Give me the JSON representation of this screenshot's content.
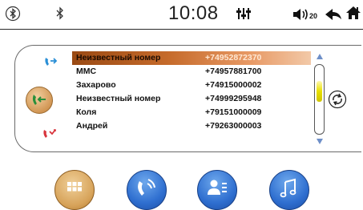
{
  "status_bar": {
    "time": "10:08",
    "volume_level": "20",
    "icons": [
      "bluetooth-circle-icon",
      "bluetooth-icon",
      "equalizer-icon",
      "volume-icon",
      "back-icon",
      "home-icon"
    ]
  },
  "call_history": {
    "filters": [
      "outgoing-call-icon",
      "all-calls-icon",
      "missed-call-icon"
    ],
    "selected_filter": "all-calls",
    "rows": [
      {
        "name": "Неизвестный номер",
        "number": "+74952872370",
        "selected": true
      },
      {
        "name": "MMC",
        "number": "+74957881700",
        "selected": false
      },
      {
        "name": "Захарово",
        "number": "+74915000002",
        "selected": false
      },
      {
        "name": "Неизвестный номер",
        "number": "+74999295948",
        "selected": false
      },
      {
        "name": "Коля",
        "number": "+79151000009",
        "selected": false
      },
      {
        "name": "Андрей",
        "number": "+79263000003",
        "selected": false
      }
    ],
    "scroll_position": 0.25
  },
  "bottom_nav": {
    "buttons": [
      "menu-grid-icon",
      "phone-calls-icon",
      "contacts-icon",
      "music-icon"
    ]
  },
  "colors": {
    "accent_orange": "#c56a2a",
    "nav_blue": "#2f6fd0",
    "nav_gold": "#d7a35a",
    "scroll_yellow": "#e8e000",
    "incoming_blue": "#2a8fd6",
    "missed_red": "#d8343c"
  }
}
